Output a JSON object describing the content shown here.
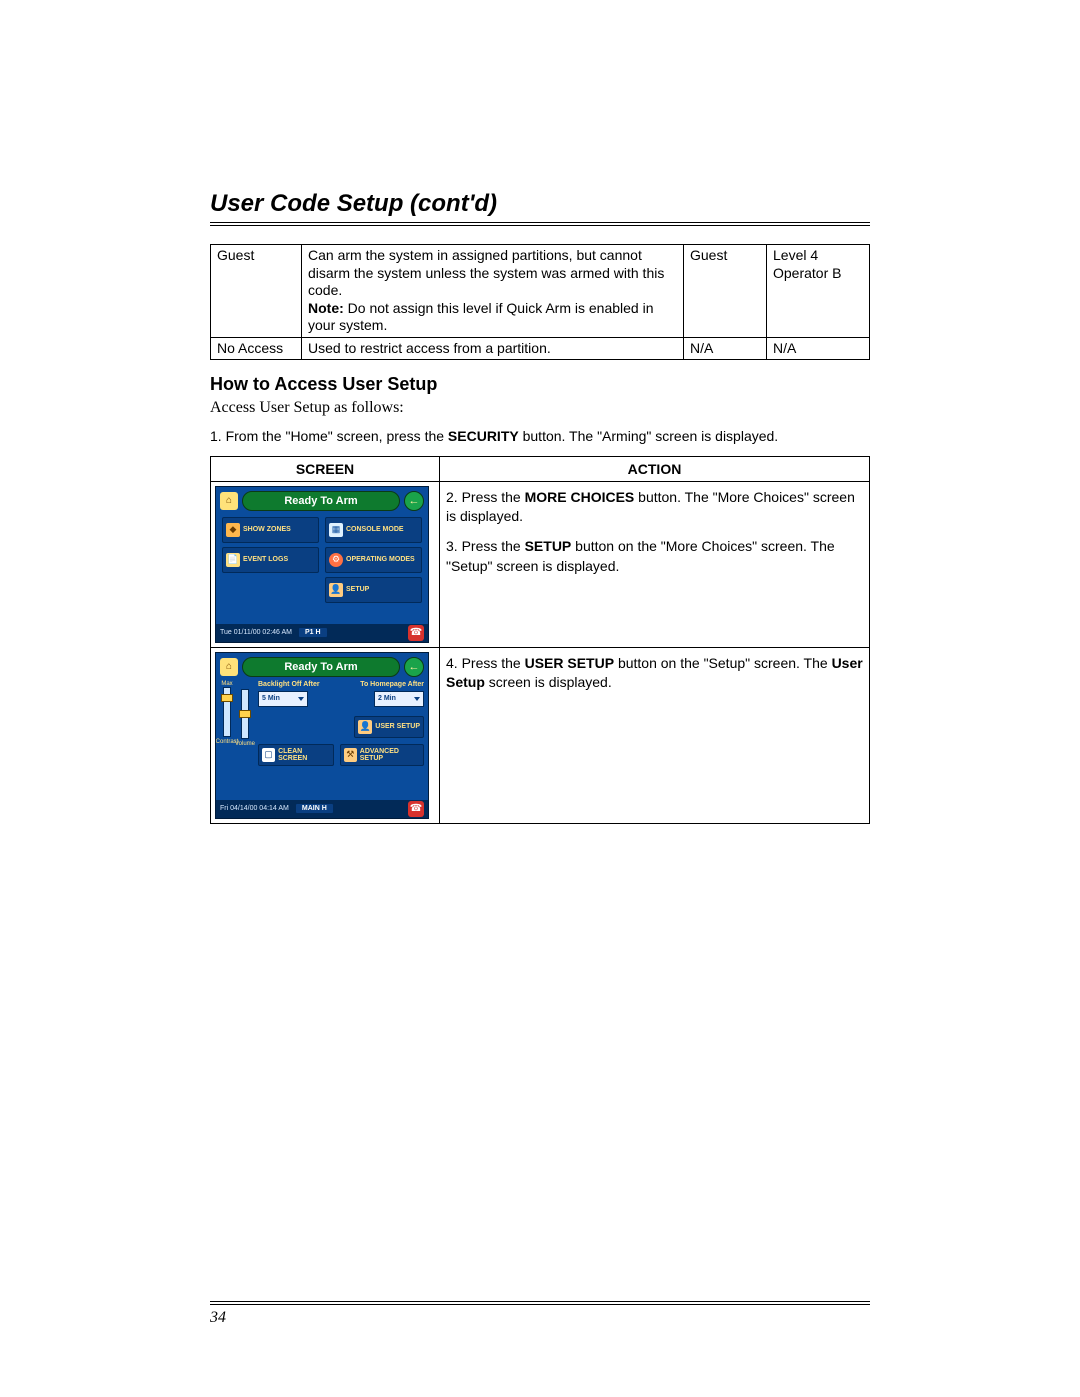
{
  "title": "User Code Setup (cont'd)",
  "top_table": {
    "rows": [
      {
        "c1": "Guest",
        "c2_main": "Can arm the system in assigned partitions, but cannot disarm the system unless the system was armed with this code.",
        "c2_note_label": "Note:",
        "c2_note": " Do not assign this level if Quick Arm is enabled in your system.",
        "c3": "Guest",
        "c4a": "Level 4",
        "c4b": "Operator B"
      },
      {
        "c1": "No Access",
        "c2_main": "Used to restrict access from a partition.",
        "c2_note_label": "",
        "c2_note": "",
        "c3": "N/A",
        "c4a": "N/A",
        "c4b": ""
      }
    ]
  },
  "section_heading": "How to Access User Setup",
  "intro": "Access User Setup as follows:",
  "step1_a": "1.  From the \"Home\" screen, press the ",
  "step1_bold": "SECURITY",
  "step1_b": " button.  The \"Arming\" screen is displayed.",
  "guide": {
    "headers": {
      "screen": "SCREEN",
      "action": "ACTION"
    },
    "rows": [
      {
        "action_parts": [
          {
            "pre": "2.  Press the ",
            "bold": "MORE CHOICES",
            "post": " button. The \"More Choices\" screen is displayed."
          },
          {
            "pre": "3.  Press the ",
            "bold": "SETUP",
            "post": " button on the \"More Choices\" screen.  The \"Setup\" screen is displayed."
          }
        ]
      },
      {
        "action_parts": [
          {
            "pre": "4.  Press the ",
            "bold": "USER SETUP",
            "post": " button on the \"Setup\" screen.  The ",
            "bold2": "User Setup",
            "post2": " screen is displayed."
          }
        ]
      }
    ]
  },
  "device1": {
    "pill": "Ready To Arm",
    "btns": [
      "SHOW ZONES",
      "CONSOLE MODE",
      "EVENT LOGS",
      "OPERATING MODES",
      "",
      "SETUP"
    ],
    "time": "Tue 01/11/00 02:46 AM",
    "tag": "P1 H"
  },
  "device2": {
    "pill": "Ready To Arm",
    "max": "Max",
    "labels": {
      "backlight": "Backlight Off After",
      "homepage": "To Homepage After"
    },
    "dropdowns": {
      "backlight": "5 Min",
      "homepage": "2 Min"
    },
    "btns": {
      "user": "USER SETUP",
      "clean": "CLEAN SCREEN",
      "adv": "ADVANCED SETUP"
    },
    "slider_caps": {
      "contrast": "Contrast",
      "volume": "Volume"
    },
    "time": "Fri 04/14/00 04:14 AM",
    "tag": "MAIN H"
  },
  "page_number": "34"
}
